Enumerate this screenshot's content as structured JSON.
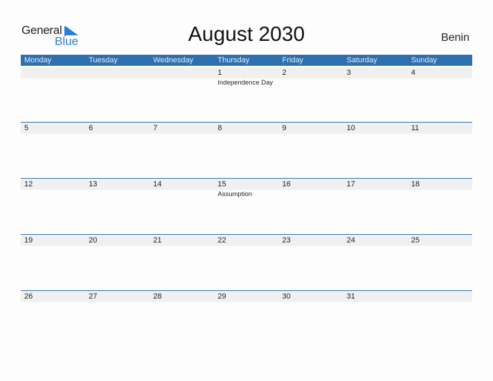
{
  "logo": {
    "word1": "General",
    "word2": "Blue",
    "brand_color": "#2a7fd4"
  },
  "title": "August 2030",
  "country": "Benin",
  "header_color": "#2e6fb0",
  "weekdays": [
    "Monday",
    "Tuesday",
    "Wednesday",
    "Thursday",
    "Friday",
    "Saturday",
    "Sunday"
  ],
  "weeks": [
    {
      "days": [
        "",
        "",
        "",
        "1",
        "2",
        "3",
        "4"
      ],
      "events": [
        "",
        "",
        "",
        "Independence Day",
        "",
        "",
        ""
      ]
    },
    {
      "days": [
        "5",
        "6",
        "7",
        "8",
        "9",
        "10",
        "11"
      ],
      "events": [
        "",
        "",
        "",
        "",
        "",
        "",
        ""
      ]
    },
    {
      "days": [
        "12",
        "13",
        "14",
        "15",
        "16",
        "17",
        "18"
      ],
      "events": [
        "",
        "",
        "",
        "Assumption",
        "",
        "",
        ""
      ]
    },
    {
      "days": [
        "19",
        "20",
        "21",
        "22",
        "23",
        "24",
        "25"
      ],
      "events": [
        "",
        "",
        "",
        "",
        "",
        "",
        ""
      ]
    },
    {
      "days": [
        "26",
        "27",
        "28",
        "29",
        "30",
        "31",
        ""
      ],
      "events": [
        "",
        "",
        "",
        "",
        "",
        "",
        ""
      ]
    }
  ]
}
